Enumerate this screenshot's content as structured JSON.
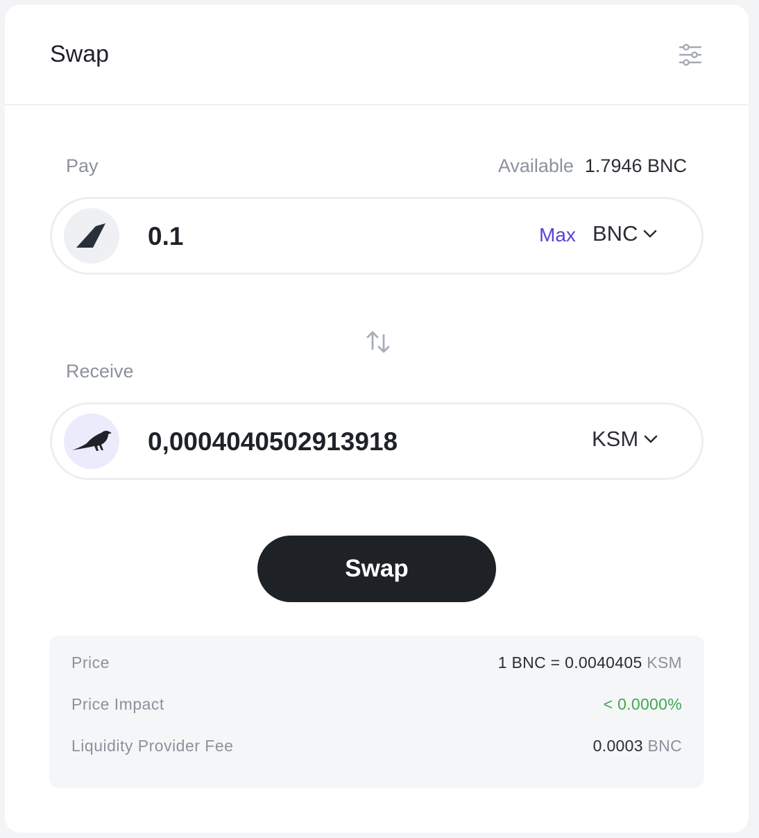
{
  "header": {
    "title": "Swap",
    "settings_icon": "sliders-icon"
  },
  "pay": {
    "label": "Pay",
    "available_label": "Available",
    "available_value": "1.7946 BNC",
    "amount": "0.1",
    "max_label": "Max",
    "token": "BNC",
    "token_icon": "bifrost-logo-icon"
  },
  "switch_icon": "swap-arrows-icon",
  "receive": {
    "label": "Receive",
    "amount": "0,0004040502913918",
    "token": "KSM",
    "token_icon": "kusama-bird-icon"
  },
  "swap_button": "Swap",
  "details": {
    "price_label": "Price",
    "price_prefix": "1 BNC = ",
    "price_value": "0.0040405",
    "price_unit": "KSM",
    "impact_label": "Price Impact",
    "impact_value": "< 0.0000%",
    "fee_label": "Liquidity Provider Fee",
    "fee_value": "0.0003",
    "fee_unit": "BNC"
  },
  "colors": {
    "accent": "#5b3fd6",
    "positive": "#3fa74f",
    "button": "#1e2126"
  }
}
